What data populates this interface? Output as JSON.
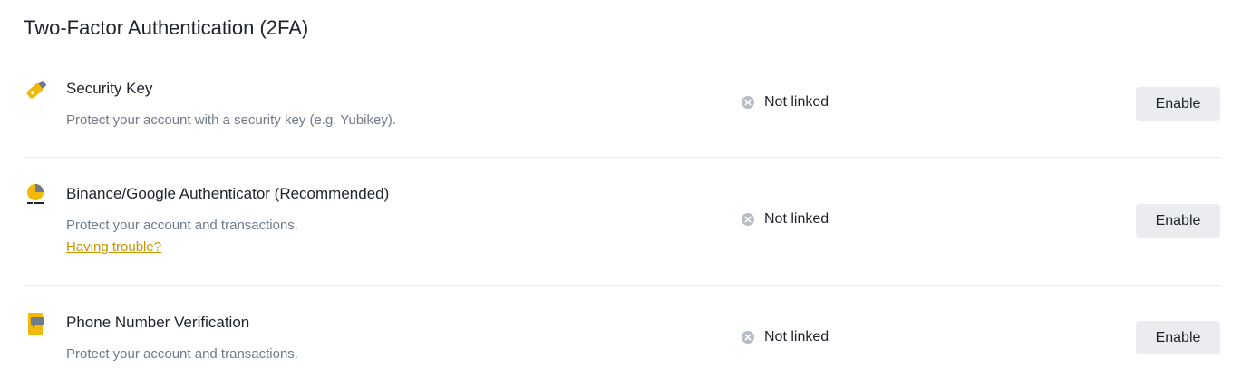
{
  "section": {
    "title": "Two-Factor Authentication (2FA)"
  },
  "colors": {
    "accent": "#f0b90b",
    "link": "#c99400",
    "muted_text": "#707a8a",
    "button_bg": "#eaecef",
    "status_icon": "#b7bdc6"
  },
  "methods": [
    {
      "icon": "security-key-icon",
      "title": "Security Key",
      "description": "Protect your account with a security key (e.g. Yubikey).",
      "status": "Not linked",
      "button": "Enable"
    },
    {
      "icon": "authenticator-icon",
      "title": "Binance/Google Authenticator (Recommended)",
      "description": "Protect your account and transactions.",
      "link": "Having trouble?",
      "status": "Not linked",
      "button": "Enable"
    },
    {
      "icon": "phone-icon",
      "title": "Phone Number Verification",
      "description": "Protect your account and transactions.",
      "status": "Not linked",
      "button": "Enable"
    }
  ]
}
